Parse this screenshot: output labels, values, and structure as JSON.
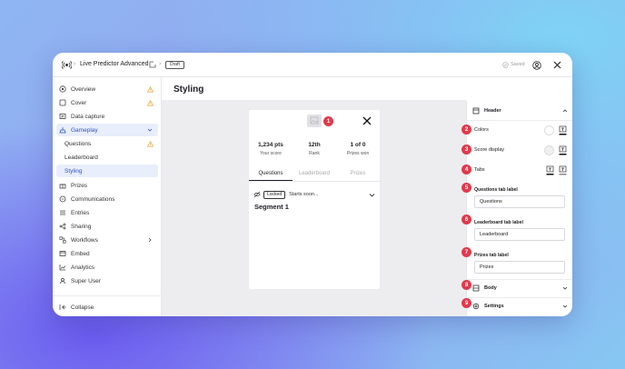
{
  "topbar": {
    "app_title": "Live Predictor Advanced",
    "separator": "›",
    "status_badge": "Draft",
    "saved_label": "Saved"
  },
  "sidebar": {
    "items": [
      {
        "label": "Overview",
        "icon": "overview-icon",
        "warning": true
      },
      {
        "label": "Cover",
        "icon": "cover-icon",
        "warning": true
      },
      {
        "label": "Data capture",
        "icon": "data-capture-icon",
        "warning": false
      },
      {
        "label": "Gameplay",
        "icon": "gameplay-icon",
        "warning": false,
        "expanded": true
      },
      {
        "label": "Questions",
        "sub": true,
        "warning": true
      },
      {
        "label": "Leaderboard",
        "sub": true
      },
      {
        "label": "Styling",
        "sub": true,
        "selected": true
      },
      {
        "label": "Prizes",
        "icon": "prizes-icon"
      },
      {
        "label": "Communications",
        "icon": "communications-icon"
      },
      {
        "label": "Entries",
        "icon": "entries-icon"
      },
      {
        "label": "Sharing",
        "icon": "sharing-icon"
      },
      {
        "label": "Workflows",
        "icon": "workflows-icon",
        "chevron": true
      },
      {
        "label": "Embed",
        "icon": "embed-icon"
      },
      {
        "label": "Analytics",
        "icon": "analytics-icon"
      },
      {
        "label": "Super User",
        "icon": "super-user-icon"
      }
    ],
    "collapse_label": "Collapse"
  },
  "main": {
    "title": "Styling"
  },
  "preview": {
    "stats": [
      {
        "value": "1,234 pts",
        "caption": "Your score"
      },
      {
        "value": "12th",
        "caption": "Rank"
      },
      {
        "value": "1 of 0",
        "caption": "Prizes won"
      }
    ],
    "tabs": [
      {
        "label": "Questions",
        "active": true
      },
      {
        "label": "Leaderboard",
        "active": false
      },
      {
        "label": "Prizes",
        "active": false
      }
    ],
    "locked_badge": "Locked",
    "starts_text": "Starts soon...",
    "segment_title": "Segment 1"
  },
  "panel": {
    "header_label": "Header",
    "colors_label": "Colors",
    "score_display_label": "Score display",
    "tabs_label": "Tabs",
    "questions_tab_label": "Questions tab label",
    "questions_tab_value": "Questions",
    "leaderboard_tab_label": "Leaderboard tab label",
    "leaderboard_tab_value": "Leaderboard",
    "prizes_tab_label": "Prizes tab label",
    "prizes_tab_value": "Prizes",
    "body_label": "Body",
    "settings_label": "Settings"
  },
  "markers": [
    "1",
    "2",
    "3",
    "4",
    "5",
    "6",
    "7",
    "8",
    "9"
  ],
  "colors": {
    "accent": "#2f55c5",
    "marker": "#e2394b",
    "warning": "#e8a23a"
  }
}
